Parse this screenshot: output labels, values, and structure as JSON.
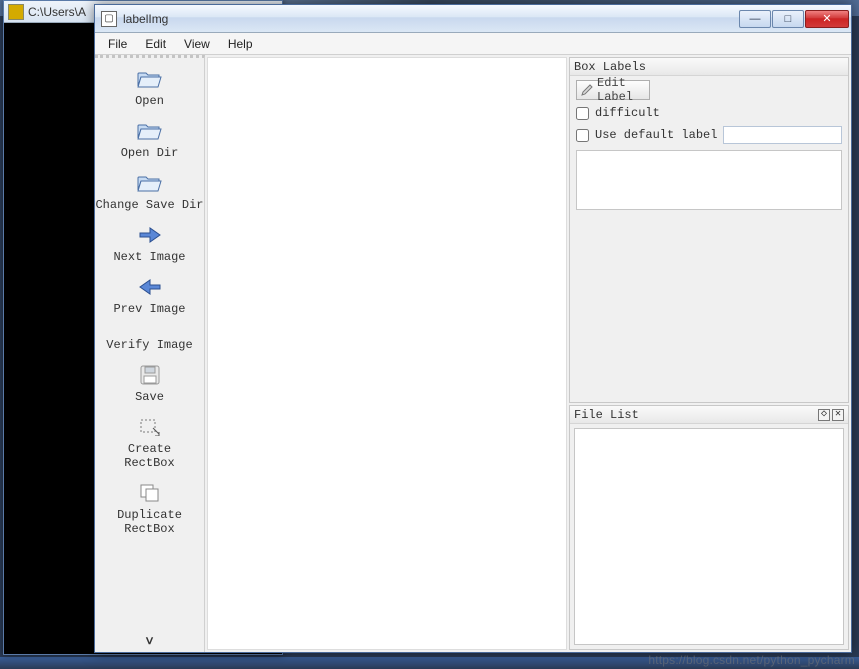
{
  "console": {
    "title": "C:\\Users\\A"
  },
  "window": {
    "title": "labelImg",
    "controls": {
      "min": "—",
      "max": "□",
      "close": "✕"
    }
  },
  "menubar": {
    "file": "File",
    "edit": "Edit",
    "view": "View",
    "help": "Help"
  },
  "toolbar": {
    "open": "Open",
    "open_dir": "Open Dir",
    "change_save_dir": "Change Save Dir",
    "next_image": "Next Image",
    "prev_image": "Prev Image",
    "verify_image": "Verify Image",
    "save": "Save",
    "create_rectbox": "Create\nRectBox",
    "duplicate_rectbox": "Duplicate\nRectBox",
    "scroll_indicator": "ｖ"
  },
  "box_labels": {
    "title": "Box Labels",
    "edit_label": "Edit Label",
    "difficult": "difficult",
    "use_default_label": "Use default label",
    "default_label_value": ""
  },
  "file_list": {
    "title": "File List"
  },
  "watermark": "https://blog.csdn.net/python_pycharm"
}
